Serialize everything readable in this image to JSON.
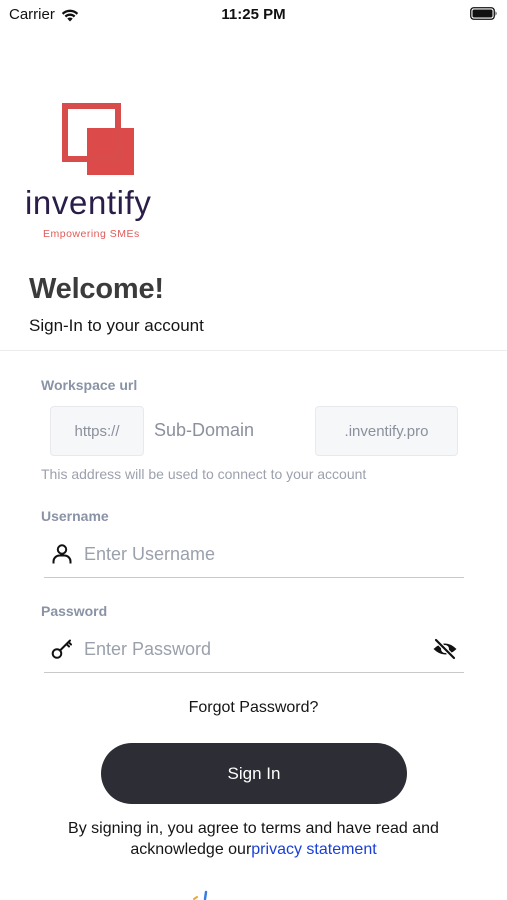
{
  "status_bar": {
    "carrier": "Carrier",
    "time": "11:25 PM"
  },
  "logo": {
    "wordmark": "inventify",
    "tagline": "Empowering SMEs",
    "brand_red": "#d94c4c",
    "brand_navy": "#2a1d4a"
  },
  "header": {
    "title": "Welcome!",
    "subtitle": "Sign-In to your account"
  },
  "workspace": {
    "label": "Workspace url",
    "prefix": "https://",
    "subdomain_placeholder": "Sub-Domain",
    "suffix": ".inventify.pro",
    "hint": "This address will be used to connect to your account"
  },
  "username": {
    "label": "Username",
    "placeholder": "Enter Username",
    "icon": "user-icon"
  },
  "password": {
    "label": "Password",
    "placeholder": "Enter Password",
    "icon": "key-icon",
    "toggle_icon": "eye-slash-icon"
  },
  "actions": {
    "forgot": "Forgot Password?",
    "signin": "Sign In"
  },
  "terms": {
    "text": "By signing in, you agree to terms and have read and acknowledge our",
    "link": "privacy statement",
    "link_color": "#1a3fd6"
  },
  "colors": {
    "button": "#2c2d35",
    "label": "#8a93a6"
  }
}
